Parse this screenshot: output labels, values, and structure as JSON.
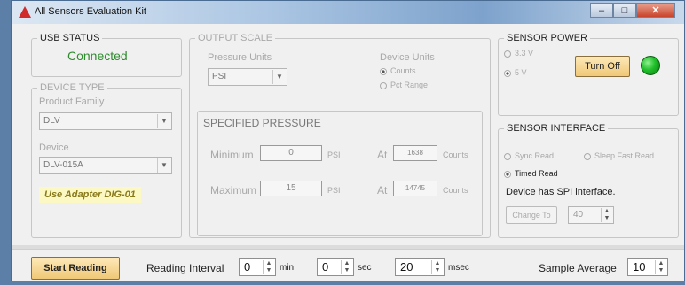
{
  "window": {
    "title": "All Sensors Evaluation Kit",
    "controls": [
      "–",
      "□",
      "✕"
    ]
  },
  "usb_status": {
    "legend": "USB STATUS",
    "value": "Connected"
  },
  "device_type": {
    "legend": "DEVICE TYPE",
    "family_label": "Product Family",
    "family_value": "DLV",
    "device_label": "Device",
    "device_value": "DLV-015A",
    "adapter_note": "Use Adapter DIG-01"
  },
  "output_scale": {
    "legend": "OUTPUT SCALE",
    "pressure_units_label": "Pressure Units",
    "pressure_units_value": "PSI",
    "device_units_label": "Device Units",
    "device_units_options": [
      "Counts",
      "Pct Range"
    ]
  },
  "specified_pressure": {
    "legend": "SPECIFIED PRESSURE",
    "min_label": "Minimum",
    "min_value": "0",
    "min_unit": "PSI",
    "max_label": "Maximum",
    "max_value": "15",
    "max_unit": "PSI",
    "at_label": "At",
    "min_counts": "1638",
    "max_counts": "14745",
    "counts_unit": "Counts"
  },
  "sensor_power": {
    "legend": "SENSOR POWER",
    "options": [
      "3.3 V",
      "5 V"
    ],
    "button": "Turn Off",
    "indicator_color": "#1fbf2a"
  },
  "sensor_interface": {
    "legend": "SENSOR INTERFACE",
    "sync_read": "Sync Read",
    "sleep_fast_read": "Sleep Fast Read",
    "timed_read": "Timed Read",
    "info": "Device has SPI interface.",
    "change_button": "Change To",
    "value": "40"
  },
  "bottom": {
    "start_button": "Start Reading",
    "interval_label": "Reading Interval",
    "min_value": "0",
    "min_unit": "min",
    "sec_value": "0",
    "sec_unit": "sec",
    "msec_value": "20",
    "msec_unit": "msec",
    "sample_label": "Sample Average",
    "sample_value": "10"
  },
  "colors": {
    "connected": "#2e8b2e",
    "adapter_bg": "#fbf8c4",
    "button_gold": "#f0c877"
  }
}
